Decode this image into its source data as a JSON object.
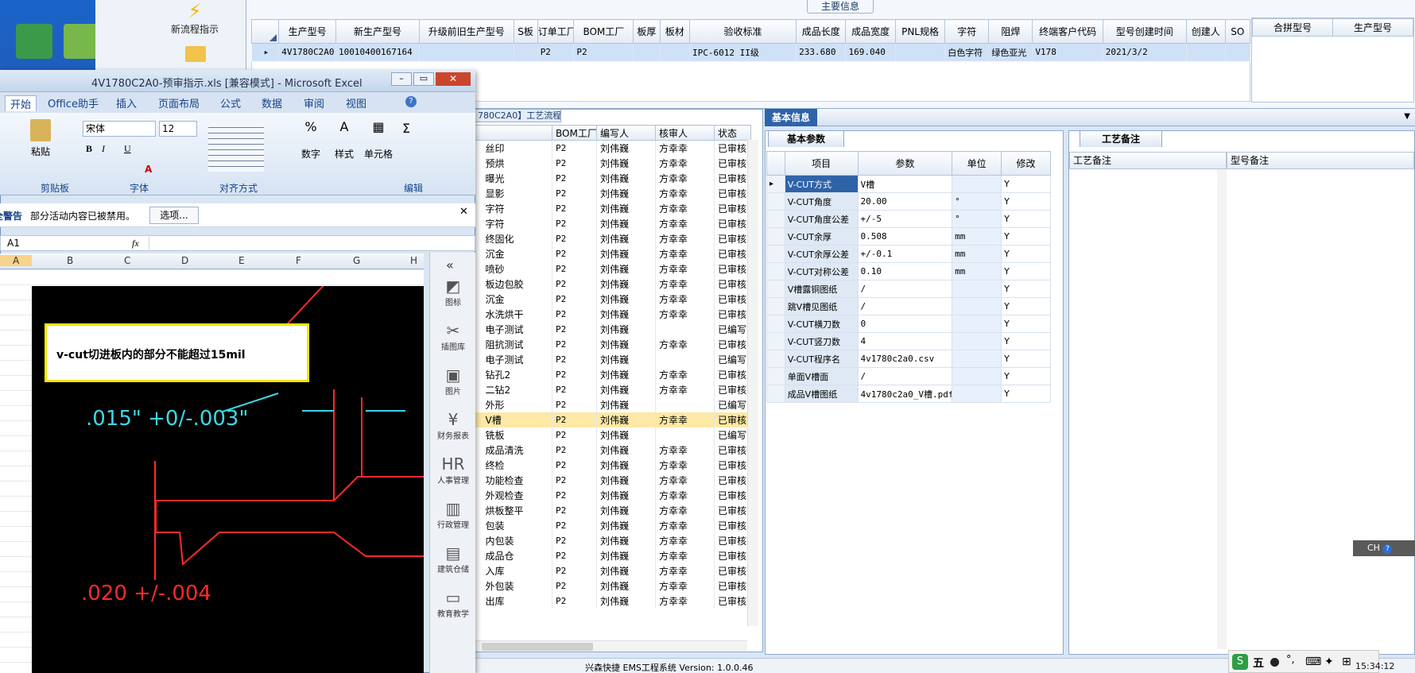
{
  "topbar": {
    "new_flow_label": "新流程指示"
  },
  "maininfo": {
    "title": "主要信息",
    "columns": [
      "生产型号",
      "新生产型号",
      "升级前旧生产型号",
      "S板",
      "订单工厂",
      "BOM工厂",
      "板厚",
      "板材",
      "验收标准",
      "成品长度",
      "成品宽度",
      "PNL规格",
      "字符",
      "阻焊",
      "终端客户代码",
      "型号创建时间",
      "创建人",
      "SO"
    ],
    "row": [
      "4V1780C2A0",
      "10010400167164",
      "",
      "",
      "P2",
      "P2",
      "",
      "",
      "IPC-6012 II级",
      "233.680",
      "169.040",
      "",
      "白色字符",
      "绿色亚光",
      "V178",
      "2021/3/2",
      "",
      ""
    ],
    "combine_cols": [
      "合拼型号",
      "生产型号"
    ]
  },
  "flow": {
    "tab_label": "780C2A0】工艺流程",
    "columns": [
      "",
      "BOM工厂",
      "编写人",
      "核审人",
      "状态"
    ],
    "rows": [
      [
        "丝印",
        "P2",
        "刘伟巍",
        "方幸幸",
        "已审核"
      ],
      [
        "预烘",
        "P2",
        "刘伟巍",
        "方幸幸",
        "已审核"
      ],
      [
        "曝光",
        "P2",
        "刘伟巍",
        "方幸幸",
        "已审核"
      ],
      [
        "显影",
        "P2",
        "刘伟巍",
        "方幸幸",
        "已审核"
      ],
      [
        "字符",
        "P2",
        "刘伟巍",
        "方幸幸",
        "已审核"
      ],
      [
        "字符",
        "P2",
        "刘伟巍",
        "方幸幸",
        "已审核"
      ],
      [
        "终固化",
        "P2",
        "刘伟巍",
        "方幸幸",
        "已审核"
      ],
      [
        "沉金",
        "P2",
        "刘伟巍",
        "方幸幸",
        "已审核"
      ],
      [
        "喷砂",
        "P2",
        "刘伟巍",
        "方幸幸",
        "已审核"
      ],
      [
        "板边包胶",
        "P2",
        "刘伟巍",
        "方幸幸",
        "已审核"
      ],
      [
        "沉金",
        "P2",
        "刘伟巍",
        "方幸幸",
        "已审核"
      ],
      [
        "水洗烘干",
        "P2",
        "刘伟巍",
        "方幸幸",
        "已审核"
      ],
      [
        "电子测试",
        "P2",
        "刘伟巍",
        "",
        "已编写"
      ],
      [
        "阻抗测试",
        "P2",
        "刘伟巍",
        "方幸幸",
        "已审核"
      ],
      [
        "电子测试",
        "P2",
        "刘伟巍",
        "",
        "已编写"
      ],
      [
        "钻孔2",
        "P2",
        "刘伟巍",
        "方幸幸",
        "已审核"
      ],
      [
        "二钻2",
        "P2",
        "刘伟巍",
        "方幸幸",
        "已审核"
      ],
      [
        "外形",
        "P2",
        "刘伟巍",
        "",
        "已编写"
      ],
      [
        "V槽",
        "P2",
        "刘伟巍",
        "方幸幸",
        "已审核"
      ],
      [
        "铣板",
        "P2",
        "刘伟巍",
        "",
        "已编写"
      ],
      [
        "成品清洗",
        "P2",
        "刘伟巍",
        "方幸幸",
        "已审核"
      ],
      [
        "终检",
        "P2",
        "刘伟巍",
        "方幸幸",
        "已审核"
      ],
      [
        "功能检查",
        "P2",
        "刘伟巍",
        "方幸幸",
        "已审核"
      ],
      [
        "外观检查",
        "P2",
        "刘伟巍",
        "方幸幸",
        "已审核"
      ],
      [
        "烘板整平",
        "P2",
        "刘伟巍",
        "方幸幸",
        "已审核"
      ],
      [
        "包装",
        "P2",
        "刘伟巍",
        "方幸幸",
        "已审核"
      ],
      [
        "内包装",
        "P2",
        "刘伟巍",
        "方幸幸",
        "已审核"
      ],
      [
        "成品仓",
        "P2",
        "刘伟巍",
        "方幸幸",
        "已审核"
      ],
      [
        "入库",
        "P2",
        "刘伟巍",
        "方幸幸",
        "已审核"
      ],
      [
        "外包装",
        "P2",
        "刘伟巍",
        "方幸幸",
        "已审核"
      ],
      [
        "出库",
        "P2",
        "刘伟巍",
        "方幸幸",
        "已审核"
      ]
    ],
    "selected_index": 18
  },
  "basic": {
    "tab_label": "基本信息",
    "params_tab": "基本参数",
    "notes_tab": "工艺备注",
    "columns": [
      "项目",
      "参数",
      "单位",
      "修改"
    ],
    "rows": [
      [
        "V-CUT方式",
        "V槽",
        "",
        "Y"
      ],
      [
        "V-CUT角度",
        "20.00",
        "°",
        "Y"
      ],
      [
        "V-CUT角度公差",
        "+/-5",
        "°",
        "Y"
      ],
      [
        "V-CUT余厚",
        "0.508",
        "mm",
        "Y"
      ],
      [
        "V-CUT余厚公差",
        "+/-0.1",
        "mm",
        "Y"
      ],
      [
        "V-CUT对称公差",
        "0.10",
        "mm",
        "Y"
      ],
      [
        "V槽露铜图纸",
        "/",
        "",
        "Y"
      ],
      [
        "跳V槽见图纸",
        "/",
        "",
        "Y"
      ],
      [
        "V-CUT横刀数",
        "0",
        "",
        "Y"
      ],
      [
        "V-CUT竖刀数",
        "4",
        "",
        "Y"
      ],
      [
        "V-CUT程序名",
        "4v1780c2a0.csv",
        "",
        "Y"
      ],
      [
        "单面V槽面",
        "/",
        "",
        "Y"
      ],
      [
        "成品V槽图纸",
        "4v1780c2a0_V槽.pdf",
        "",
        "Y"
      ]
    ],
    "notes_col1": "工艺备注",
    "notes_col2": "型号备注"
  },
  "status": {
    "text": "兴森快捷 EMS工程系统 Version: 1.0.0.46"
  },
  "excel": {
    "title": "4V1780C2A0-预审指示.xls [兼容模式] - Microsoft Excel",
    "tabs": [
      "开始",
      "Office助手",
      "插入",
      "页面布局",
      "公式",
      "数据",
      "审阅",
      "视图"
    ],
    "font_name": "宋体",
    "font_size": "12",
    "groups": [
      "剪贴板",
      "字体",
      "对齐方式",
      "编辑"
    ],
    "big_buttons": [
      "粘贴",
      "数字",
      "样式",
      "单元格"
    ],
    "warning_title": "安全警告",
    "warning_text": "部分活动内容已被禁用。",
    "warning_button": "选项...",
    "cell_ref": "A1",
    "fx": "fx",
    "col_headers": [
      "A",
      "B",
      "C",
      "D",
      "E",
      "F",
      "G",
      "H"
    ],
    "callout_text": "v-cut切进板内的部分不能超过15mil",
    "dim1": ".015\"  +0/-.003\"",
    "dim2": ".020 +/-.004"
  },
  "side_icons": [
    {
      "label": "图标",
      "icon": "chart-icon"
    },
    {
      "label": "插图库",
      "icon": "clipart-icon"
    },
    {
      "label": "图片",
      "icon": "picture-icon"
    },
    {
      "label": "财务报表",
      "icon": "finance-icon"
    },
    {
      "label": "人事管理",
      "icon": "hr-icon"
    },
    {
      "label": "行政管理",
      "icon": "admin-icon"
    },
    {
      "label": "建筑仓储",
      "icon": "building-icon"
    },
    {
      "label": "教育教学",
      "icon": "education-icon"
    }
  ],
  "ime": {
    "label": "五",
    "float": "CH",
    "time": "15:34:12"
  }
}
